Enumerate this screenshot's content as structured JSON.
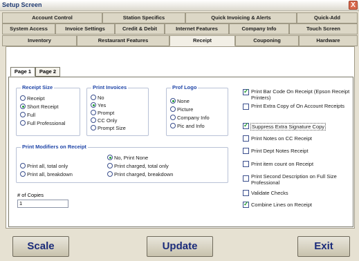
{
  "window": {
    "title": "Setup Screen",
    "close_glyph": "X"
  },
  "tabs": {
    "row1": [
      "Account Control",
      "Station Specifics",
      "Quick Invoicing & Alerts",
      "Quick-Add"
    ],
    "row2": [
      "System Access",
      "Invoice Settings",
      "Credit & Debit",
      "Internet Features",
      "Company Info",
      "Touch Screen"
    ],
    "row3": [
      "Inventory",
      "Restaurant Features",
      "Receipt",
      "Couponing",
      "Hardware"
    ],
    "active": "Receipt"
  },
  "subtabs": [
    "Page 1",
    "Page 2"
  ],
  "receipt_size": {
    "label": "Receipt Size",
    "options": [
      "Receipt",
      "Short Receipt",
      "Full",
      "Full Professional"
    ],
    "selected": "Short Receipt"
  },
  "print_invoices": {
    "label": "Print Invoices",
    "options": [
      "No",
      "Yes",
      "Prompt",
      "CC Only",
      "Prompt Size"
    ],
    "selected": "Yes"
  },
  "prof_logo": {
    "label": "Prof Logo",
    "options": [
      "None",
      "Picture",
      "Company Info",
      "Pic and Info"
    ],
    "selected": "None"
  },
  "print_modifiers": {
    "label": "Print Modifiers on Receipt",
    "options": [
      "No, Print None",
      "Print all, total only",
      "Print charged, total only",
      "Print all, breakdown",
      "Print charged, breakdown"
    ],
    "selected": "No, Print None"
  },
  "copies": {
    "label": "# of Copies",
    "value": "1"
  },
  "checkboxes": [
    {
      "label": "Print Bar Code On Receipt (Epson Receipt Printers)",
      "checked": true
    },
    {
      "label": "Print Extra Copy of On Account Receipts",
      "checked": false
    },
    {
      "label": "Suppress Extra Signature Copy",
      "checked": true
    },
    {
      "label": "Print Notes on CC Receipt",
      "checked": false
    },
    {
      "label": "Print Dept Notes Receipt",
      "checked": false
    },
    {
      "label": "Print item count on Receipt",
      "checked": false
    },
    {
      "label": "Print Second Description on Full Size Professional",
      "checked": false
    },
    {
      "label": "Validate Checks",
      "checked": false
    },
    {
      "label": "Combine Lines on Receipt",
      "checked": true
    }
  ],
  "buttons": {
    "scale": "Scale",
    "update": "Update",
    "exit": "Exit"
  }
}
